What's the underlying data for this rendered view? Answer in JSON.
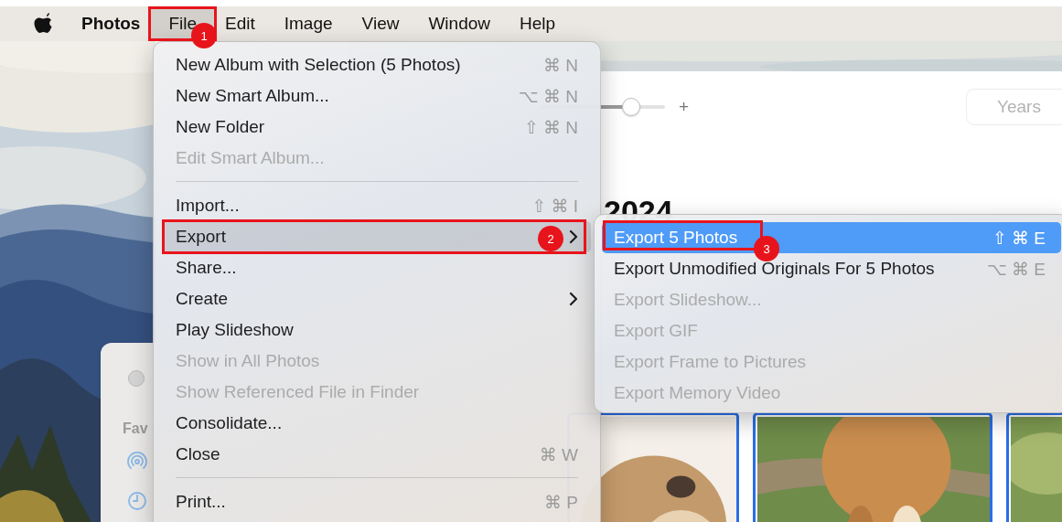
{
  "menu_bar": {
    "app_name": "Photos",
    "menus": [
      {
        "label": "File",
        "selected": true
      },
      {
        "label": "Edit",
        "selected": false
      },
      {
        "label": "Image",
        "selected": false
      },
      {
        "label": "View",
        "selected": false
      },
      {
        "label": "Window",
        "selected": false
      },
      {
        "label": "Help",
        "selected": false
      }
    ]
  },
  "file_menu": {
    "items": [
      {
        "kind": "item",
        "label": "New Album with Selection (5 Photos)",
        "shortcut": "⌘ N",
        "disabled": false,
        "selected": false,
        "submenu": false
      },
      {
        "kind": "item",
        "label": "New Smart Album...",
        "shortcut": "⌥ ⌘ N",
        "disabled": false,
        "selected": false,
        "submenu": false
      },
      {
        "kind": "item",
        "label": "New Folder",
        "shortcut": "⇧ ⌘ N",
        "disabled": false,
        "selected": false,
        "submenu": false
      },
      {
        "kind": "item",
        "label": "Edit Smart Album...",
        "disabled": true,
        "selected": false,
        "submenu": false
      },
      {
        "kind": "separator"
      },
      {
        "kind": "item",
        "label": "Import...",
        "shortcut": "⇧ ⌘ I",
        "disabled": false,
        "selected": false,
        "submenu": false
      },
      {
        "kind": "item",
        "label": "Export",
        "disabled": false,
        "selected": true,
        "submenu": true
      },
      {
        "kind": "item",
        "label": "Share...",
        "disabled": false,
        "selected": false,
        "submenu": false
      },
      {
        "kind": "item",
        "label": "Create",
        "disabled": false,
        "selected": false,
        "submenu": true
      },
      {
        "kind": "item",
        "label": "Play Slideshow",
        "disabled": false,
        "selected": false,
        "submenu": false
      },
      {
        "kind": "item",
        "label": "Show in All Photos",
        "disabled": true,
        "selected": false,
        "submenu": false
      },
      {
        "kind": "item",
        "label": "Show Referenced File in Finder",
        "disabled": true,
        "selected": false,
        "submenu": false
      },
      {
        "kind": "item",
        "label": "Consolidate...",
        "disabled": false,
        "selected": false,
        "submenu": false
      },
      {
        "kind": "item",
        "label": "Close",
        "shortcut": "⌘ W",
        "disabled": false,
        "selected": false,
        "submenu": false
      },
      {
        "kind": "separator"
      },
      {
        "kind": "item",
        "label": "Print...",
        "shortcut": "⌘ P",
        "disabled": false,
        "selected": false,
        "submenu": false
      }
    ]
  },
  "export_submenu": {
    "items": [
      {
        "kind": "item",
        "label": "Export 5 Photos",
        "shortcut": "⇧ ⌘ E",
        "disabled": false,
        "selected": true,
        "submenu": false
      },
      {
        "kind": "item",
        "label": "Export Unmodified Originals For 5 Photos",
        "shortcut": "⌥ ⌘ E",
        "disabled": false,
        "selected": false,
        "submenu": false
      },
      {
        "kind": "item",
        "label": "Export Slideshow...",
        "disabled": true,
        "selected": false,
        "submenu": false
      },
      {
        "kind": "item",
        "label": "Export GIF",
        "disabled": true,
        "selected": false,
        "submenu": false
      },
      {
        "kind": "item",
        "label": "Export Frame to Pictures",
        "disabled": true,
        "selected": false,
        "submenu": false
      },
      {
        "kind": "item",
        "label": "Export Memory Video",
        "disabled": true,
        "selected": false,
        "submenu": false
      }
    ]
  },
  "window": {
    "zoom_slider": {
      "level": 0.73
    },
    "zoom_in": "+",
    "view_button": "Years",
    "year_heading": "2024",
    "sidebar": {
      "section_label": "Fav"
    },
    "photos": [
      {
        "kind": "picture",
        "selected": true
      },
      {
        "kind": "picture",
        "selected": true
      },
      {
        "kind": "picture",
        "selected": true
      }
    ]
  },
  "annotations": [
    {
      "number": "1"
    },
    {
      "number": "2"
    },
    {
      "number": "3"
    }
  ]
}
